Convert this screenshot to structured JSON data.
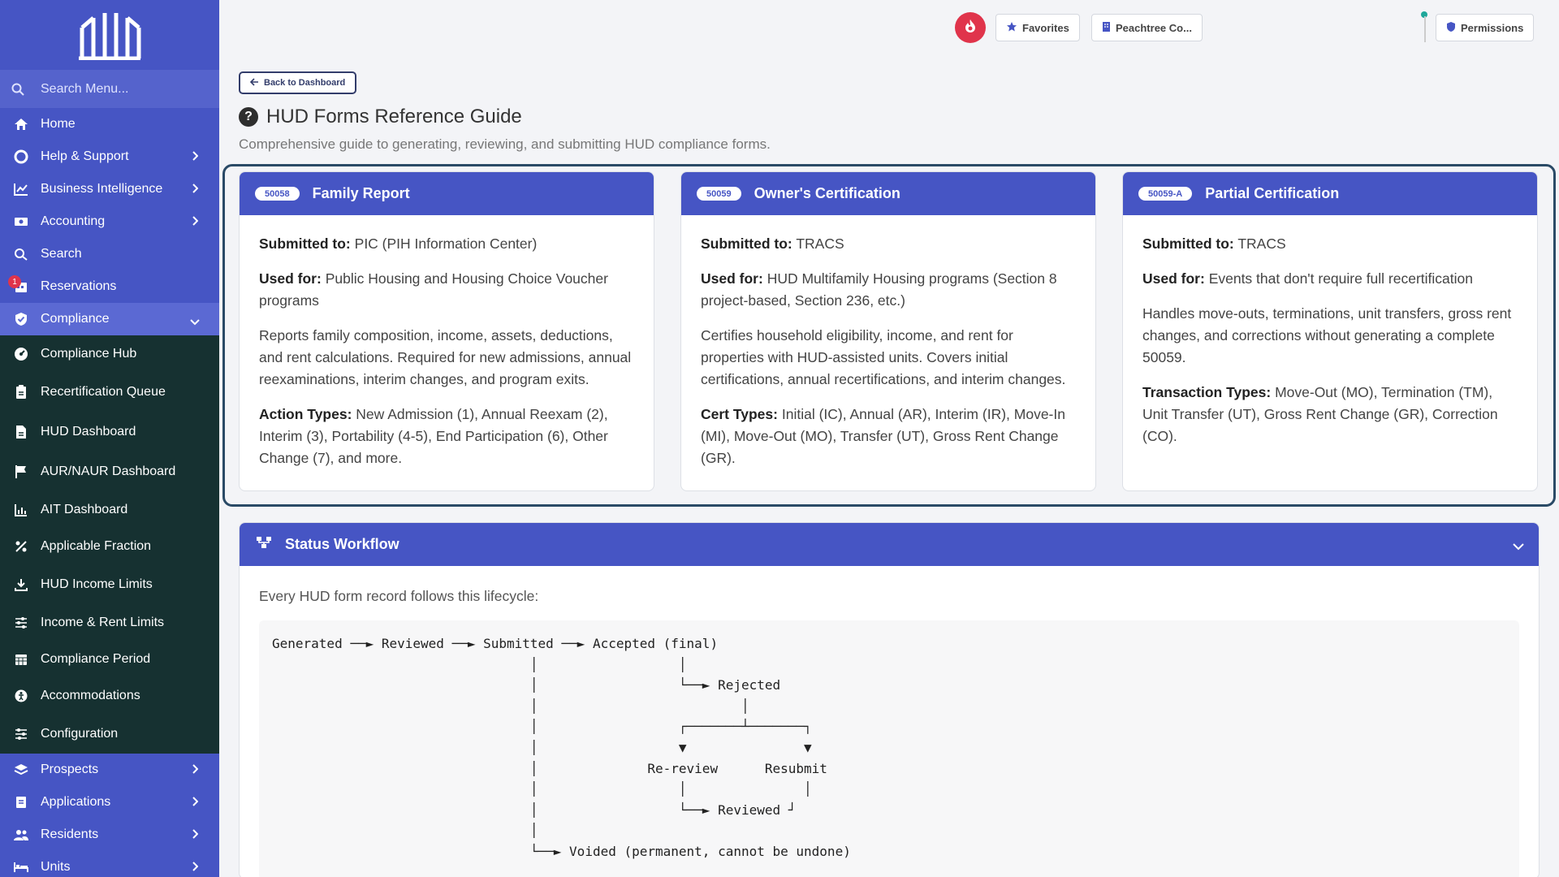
{
  "sidebar": {
    "search_placeholder": "Search Menu...",
    "items": [
      {
        "label": "Home"
      },
      {
        "label": "Help & Support"
      },
      {
        "label": "Business Intelligence"
      },
      {
        "label": "Accounting"
      },
      {
        "label": "Search"
      },
      {
        "label": "Reservations",
        "badge": "1"
      },
      {
        "label": "Compliance"
      }
    ],
    "compliance_items": [
      {
        "label": "Compliance Hub"
      },
      {
        "label": "Recertification Queue"
      },
      {
        "label": "HUD Dashboard"
      },
      {
        "label": "AUR/NAUR Dashboard"
      },
      {
        "label": "AIT Dashboard"
      },
      {
        "label": "Applicable Fraction"
      },
      {
        "label": "HUD Income Limits"
      },
      {
        "label": "Income & Rent Limits"
      },
      {
        "label": "Compliance Period"
      },
      {
        "label": "Accommodations"
      },
      {
        "label": "Configuration"
      }
    ],
    "bottom_items": [
      {
        "label": "Prospects"
      },
      {
        "label": "Applications"
      },
      {
        "label": "Residents"
      },
      {
        "label": "Units"
      }
    ]
  },
  "topbar": {
    "favorites": "Favorites",
    "property": "Peachtree Co...",
    "permissions": "Permissions"
  },
  "page": {
    "back_label": "Back to Dashboard",
    "title": "HUD Forms Reference Guide",
    "subtitle": "Comprehensive guide to generating, reviewing, and submitting HUD compliance forms."
  },
  "cards": [
    {
      "code": "50058",
      "title": "Family Report",
      "submitted_label": "Submitted to:",
      "submitted_value": "PIC (PIH Information Center)",
      "used_label": "Used for:",
      "used_value": "Public Housing and Housing Choice Voucher programs",
      "description": "Reports family composition, income, assets, deductions, and rent calculations. Required for new admissions, annual reexaminations, interim changes, and program exits.",
      "types_label": "Action Types:",
      "types_value": "New Admission (1), Annual Reexam (2), Interim (3), Portability (4-5), End Participation (6), Other Change (7), and more."
    },
    {
      "code": "50059",
      "title": "Owner's Certification",
      "submitted_label": "Submitted to:",
      "submitted_value": "TRACS",
      "used_label": "Used for:",
      "used_value": "HUD Multifamily Housing programs (Section 8 project-based, Section 236, etc.)",
      "description": "Certifies household eligibility, income, and rent for properties with HUD-assisted units. Covers initial certifications, annual recertifications, and interim changes.",
      "types_label": "Cert Types:",
      "types_value": "Initial (IC), Annual (AR), Interim (IR), Move-In (MI), Move-Out (MO), Transfer (UT), Gross Rent Change (GR)."
    },
    {
      "code": "50059-A",
      "title": "Partial Certification",
      "submitted_label": "Submitted to:",
      "submitted_value": "TRACS",
      "used_label": "Used for:",
      "used_value": "Events that don't require full recertification",
      "description": "Handles move-outs, terminations, unit transfers, gross rent changes, and corrections without generating a complete 50059.",
      "types_label": "Transaction Types:",
      "types_value": "Move-Out (MO), Termination (TM), Unit Transfer (UT), Gross Rent Change (GR), Correction (CO)."
    }
  ],
  "workflow": {
    "title": "Status Workflow",
    "intro": "Every HUD form record follows this lifecycle:",
    "diagram": "Generated ──► Reviewed ──► Submitted ──► Accepted (final)\n                                 │                  │\n                                 │                  └──► Rejected\n                                 │                          │\n                                 │                  ┌───────┴───────┐\n                                 │                  ▼               ▼\n                                 │              Re-review      Resubmit\n                                 │                  │               │\n                                 │                  └──► Reviewed ┘\n                                 │\n                                 └──► Voided (permanent, cannot be undone)"
  },
  "colors": {
    "primary": "#4655c4",
    "sidebar_dark": "#163131",
    "accent_red": "#e0344b",
    "border_dark": "#2a4a66"
  }
}
